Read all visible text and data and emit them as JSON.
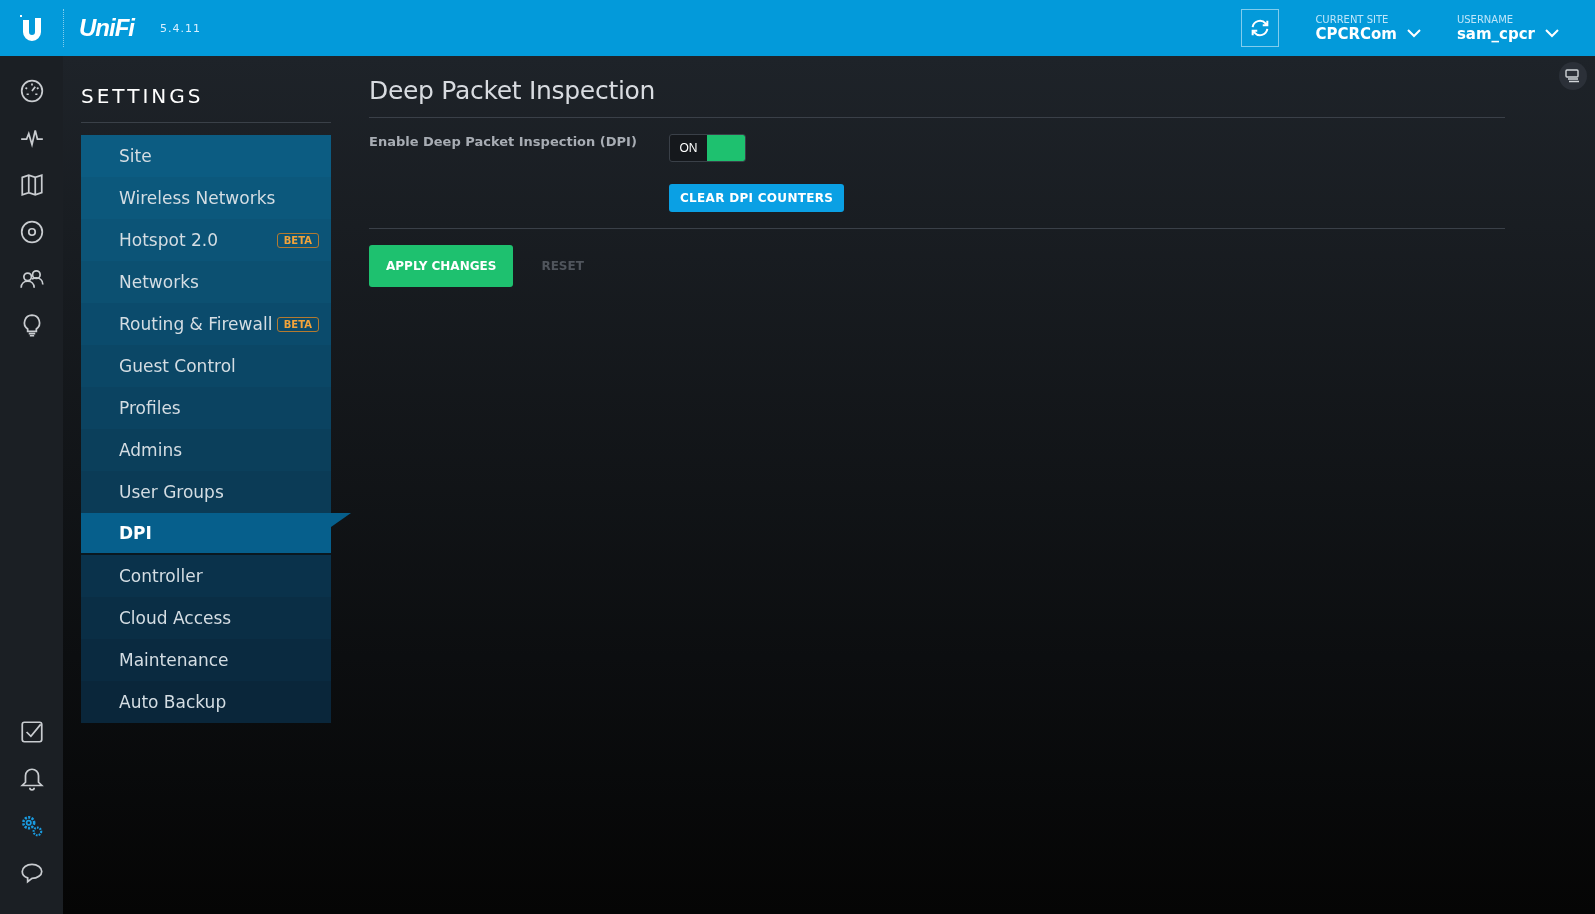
{
  "header": {
    "logo": "UniFi",
    "version": "5.4.11",
    "current_site": {
      "label": "CURRENT SITE",
      "value": "CPCRCom"
    },
    "username": {
      "label": "USERNAME",
      "value": "sam_cpcr"
    }
  },
  "rail": {
    "top": [
      {
        "kind": "dashboard",
        "selected": false
      },
      {
        "kind": "statistics",
        "selected": false
      },
      {
        "kind": "map",
        "selected": false
      },
      {
        "kind": "devices",
        "selected": false
      },
      {
        "kind": "clients",
        "selected": false
      },
      {
        "kind": "insights",
        "selected": false
      }
    ],
    "bottom": [
      {
        "kind": "events",
        "selected": false
      },
      {
        "kind": "alerts",
        "selected": false
      },
      {
        "kind": "settings",
        "selected": true
      },
      {
        "kind": "chat",
        "selected": false
      }
    ]
  },
  "sidebar": {
    "title": "SETTINGS",
    "items": [
      {
        "label": "Site",
        "selected": false
      },
      {
        "label": "Wireless Networks",
        "selected": false
      },
      {
        "label": "Hotspot 2.0",
        "selected": false,
        "badge": "BETA"
      },
      {
        "label": "Networks",
        "selected": false
      },
      {
        "label": "Routing & Firewall",
        "selected": false,
        "badge": "BETA"
      },
      {
        "label": "Guest Control",
        "selected": false
      },
      {
        "label": "Profiles",
        "selected": false
      },
      {
        "label": "Admins",
        "selected": false
      },
      {
        "label": "User Groups",
        "selected": false
      },
      {
        "label": "DPI",
        "selected": true
      },
      {
        "label": "Controller",
        "selected": false
      },
      {
        "label": "Cloud Access",
        "selected": false
      },
      {
        "label": "Maintenance",
        "selected": false
      },
      {
        "label": "Auto Backup",
        "selected": false
      }
    ]
  },
  "content": {
    "title": "Deep Packet Inspection",
    "setting": {
      "label": "Enable Deep Packet Inspection (DPI)",
      "toggle": {
        "label": "ON",
        "on": true
      }
    },
    "clear_button": "CLEAR DPI COUNTERS",
    "apply_button": "APPLY CHANGES",
    "reset_button": "RESET"
  }
}
